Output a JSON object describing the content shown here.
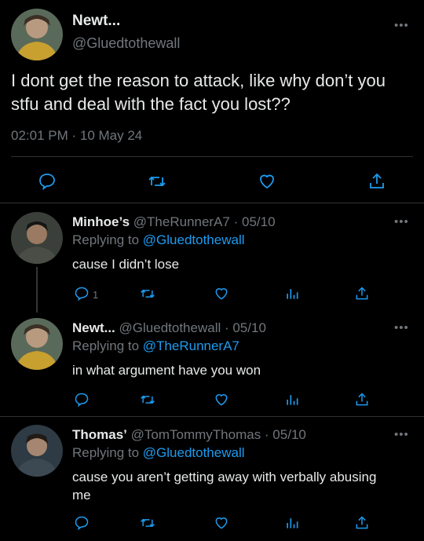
{
  "main_tweet": {
    "author_name": "Newt...",
    "handle": "@Gluedtothewall",
    "text": "I dont get the reason to attack, like why don’t you stfu and deal with the fact you lost??",
    "timestamp": "02:01 PM · 10 May 24"
  },
  "replies": [
    {
      "author_name": "Minhoe’s",
      "meta": "@TheRunnerA7 · 05/10",
      "replying_prefix": "Replying to ",
      "replying_to": "@Gluedtothewall",
      "text": "cause I didn’t lose",
      "reply_count": "1"
    },
    {
      "author_name": "Newt...",
      "meta": "@Gluedtothewall · 05/10",
      "replying_prefix": "Replying to ",
      "replying_to": "@TheRunnerA7",
      "text": "in what argument have you won",
      "reply_count": ""
    },
    {
      "author_name": "Thomas’",
      "meta": "@TomTommyThomas · 05/10",
      "replying_prefix": "Replying to ",
      "replying_to": "@Gluedtothewall",
      "text": "cause you aren’t getting away with verbally abusing me",
      "reply_count": ""
    }
  ],
  "icons": {
    "more": "more-icon",
    "reply": "reply-icon",
    "retweet": "retweet-icon",
    "like": "like-icon",
    "share": "share-icon",
    "analytics": "analytics-icon"
  },
  "colors": {
    "background": "#000000",
    "text": "#e7e9ea",
    "muted": "#71767b",
    "link": "#1d9bf0",
    "divider": "#2f3336"
  }
}
